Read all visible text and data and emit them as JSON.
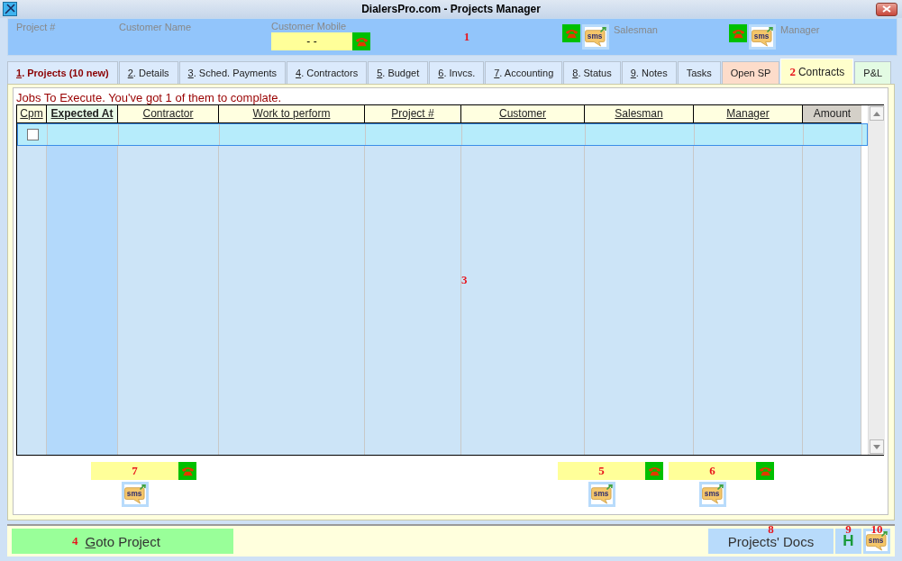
{
  "window": {
    "title": "DialersPro.com - Projects Manager"
  },
  "header": {
    "project_label": "Project #",
    "customer_name_label": "Customer Name",
    "customer_mobile": {
      "label": "Customer Mobile",
      "value": "-  -"
    },
    "marker": "1",
    "salesman": {
      "label": "Salesman",
      "sms": "sms"
    },
    "manager": {
      "label": "Manager",
      "sms": "sms"
    }
  },
  "tabs": [
    {
      "label": "1. Projects (10 new)",
      "mnemonic": true,
      "emphasis": true,
      "selected": false,
      "color": "#dbeafc"
    },
    {
      "label": "2. Details",
      "mnemonic": true,
      "emphasis": false,
      "selected": false,
      "color": "#dbeafc"
    },
    {
      "label": "3. Sched. Payments",
      "mnemonic": true,
      "emphasis": false,
      "selected": false,
      "color": "#dbeafc"
    },
    {
      "label": "4. Contractors",
      "mnemonic": true,
      "emphasis": false,
      "selected": false,
      "color": "#dbeafc"
    },
    {
      "label": "5. Budget",
      "mnemonic": true,
      "emphasis": false,
      "selected": false,
      "color": "#dbeafc"
    },
    {
      "label": "6. Invcs.",
      "mnemonic": true,
      "emphasis": false,
      "selected": false,
      "color": "#dbeafc"
    },
    {
      "label": "7. Accounting",
      "mnemonic": true,
      "emphasis": false,
      "selected": false,
      "color": "#dbeafc"
    },
    {
      "label": "8. Status",
      "mnemonic": true,
      "emphasis": false,
      "selected": false,
      "color": "#dbeafc"
    },
    {
      "label": "9. Notes",
      "mnemonic": true,
      "emphasis": false,
      "selected": false,
      "color": "#dbeafc"
    },
    {
      "label": "Tasks",
      "mnemonic": false,
      "emphasis": false,
      "selected": false,
      "color": "#dbeafc"
    },
    {
      "label": "Open SP",
      "mnemonic": false,
      "emphasis": false,
      "selected": false,
      "color": "#fddcca"
    },
    {
      "marker": "2",
      "label": "Contracts",
      "mnemonic": false,
      "emphasis": false,
      "selected": true,
      "color": "#ffffcc"
    },
    {
      "label": "P&L",
      "mnemonic": false,
      "emphasis": false,
      "selected": false,
      "color": "#e3fbe3"
    }
  ],
  "message": "Jobs To Execute. You've got 1 of them to complate.",
  "table": {
    "columns": [
      {
        "label": "Cpm",
        "kind": "link"
      },
      {
        "label": "Expected At",
        "kind": "sorted"
      },
      {
        "label": "Contractor",
        "kind": "link"
      },
      {
        "label": "Work to perform",
        "kind": "link"
      },
      {
        "label": "Project #",
        "kind": "link"
      },
      {
        "label": "Customer",
        "kind": "link"
      },
      {
        "label": "Salesman",
        "kind": "link"
      },
      {
        "label": "Manager",
        "kind": "link"
      },
      {
        "label": "Amount",
        "kind": "plain"
      }
    ],
    "rows": [
      {
        "selected": true,
        "checked": false
      }
    ],
    "marker": "3"
  },
  "contacts": [
    {
      "marker": "7",
      "sms": "sms"
    },
    {
      "marker": "5",
      "sms": "sms"
    },
    {
      "marker": "6",
      "sms": "sms"
    }
  ],
  "footer": {
    "goto": {
      "marker": "4",
      "label": "Goto Project",
      "mnemonic": true
    },
    "docs": {
      "marker": "8",
      "label": "Projects' Docs"
    },
    "h_button": {
      "marker": "9",
      "label": "H"
    },
    "sms_button": {
      "marker": "10",
      "sms": "sms"
    }
  }
}
